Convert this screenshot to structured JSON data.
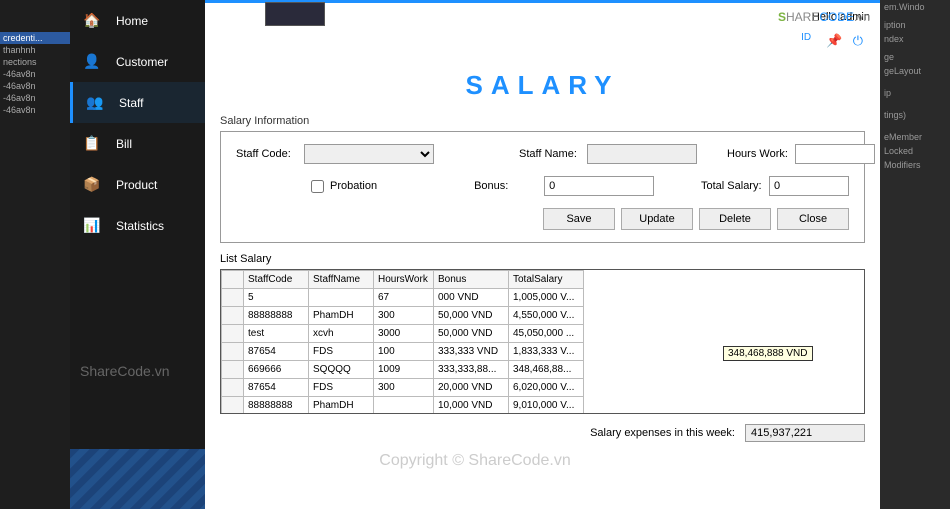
{
  "bgLeft": {
    "items": [
      "",
      "credenti...",
      "thanhnh",
      "nections",
      "-46av8n",
      "-46av8n",
      "-46av8n",
      "-46av8n"
    ]
  },
  "bgRight": {
    "items": [
      "em.Windo",
      "",
      "iption",
      "ndex",
      "",
      "ge",
      "geLayout",
      "",
      "",
      "ip",
      "",
      "",
      "tings)",
      "",
      "",
      "eMember",
      "Locked",
      "Modifiers"
    ]
  },
  "sidebar": {
    "items": [
      {
        "icon": "🏠",
        "label": "Home"
      },
      {
        "icon": "👤",
        "label": "Customer"
      },
      {
        "icon": "👥",
        "label": "Staff"
      },
      {
        "icon": "📋",
        "label": "Bill"
      },
      {
        "icon": "📦",
        "label": "Product"
      },
      {
        "icon": "📊",
        "label": "Statistics"
      }
    ],
    "watermark": "ShareCode.vn"
  },
  "header": {
    "hello": "Hello:admin",
    "id": "ID"
  },
  "title": "SALARY",
  "sectionLabel": "Salary Information",
  "form": {
    "staffCodeLabel": "Staff Code:",
    "staffNameLabel": "Staff Name:",
    "hoursLabel": "Hours Work:",
    "probationLabel": "Probation",
    "bonusLabel": "Bonus:",
    "bonusValue": "0",
    "totalLabel": "Total Salary:",
    "totalValue": "0"
  },
  "buttons": {
    "save": "Save",
    "update": "Update",
    "delete": "Delete",
    "close": "Close"
  },
  "listLabel": "List Salary",
  "columns": [
    "StaffCode",
    "StaffName",
    "HoursWork",
    "Bonus",
    "TotalSalary"
  ],
  "rows": [
    {
      "code": "5",
      "name": "",
      "hours": "67",
      "bonus": "000 VND",
      "total": "1,005,000 V..."
    },
    {
      "code": "88888888",
      "name": "PhamDH",
      "hours": "300",
      "bonus": "50,000 VND",
      "total": "4,550,000 V..."
    },
    {
      "code": "test",
      "name": "xcvh",
      "hours": "3000",
      "bonus": "50,000 VND",
      "total": "45,050,000 ..."
    },
    {
      "code": "87654",
      "name": "FDS",
      "hours": "100",
      "bonus": "333,333 VND",
      "total": "1,833,333 V..."
    },
    {
      "code": "669666",
      "name": "SQQQQ",
      "hours": "1009",
      "bonus": "333,333,88...",
      "total": "348,468,88..."
    },
    {
      "code": "87654",
      "name": "FDS",
      "hours": "300",
      "bonus": "20,000 VND",
      "total": "6,020,000 V..."
    },
    {
      "code": "88888888",
      "name": "PhamDH",
      "hours": "",
      "bonus": "10,000 VND",
      "total": "9,010,000 V..."
    }
  ],
  "tooltip": "348,468,888 VND",
  "bottom": {
    "label": "Salary expenses in this week:",
    "value": "415,937,221"
  },
  "watermark": {
    "center": "Copyright © ShareCode.vn",
    "logo_s": "S",
    "logo_share": "HARE",
    "logo_code": "CODE",
    "logo_vn": ".vn"
  }
}
